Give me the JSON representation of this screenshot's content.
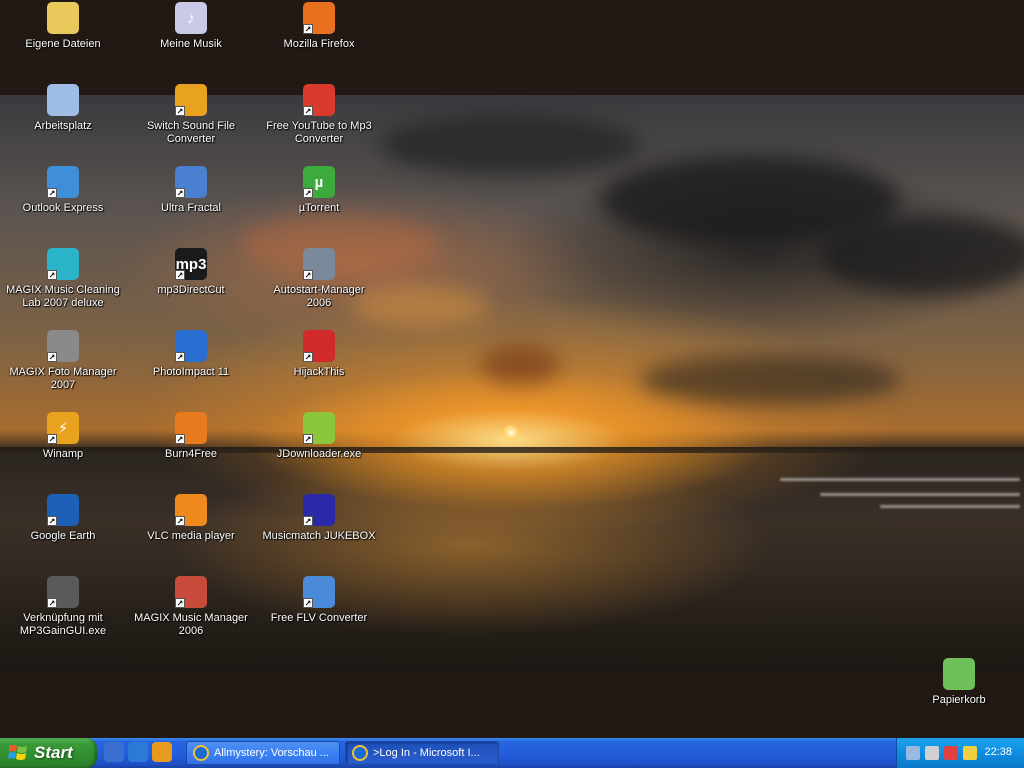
{
  "desktop": {
    "icons": [
      {
        "label": "Eigene Dateien",
        "icon": "folder-icon",
        "color": "#e9c95b",
        "glyph": "",
        "shortcut": false
      },
      {
        "label": "Meine Musik",
        "icon": "music-cd-icon",
        "color": "#c9c9e8",
        "glyph": "♪",
        "shortcut": false
      },
      {
        "label": "Mozilla Firefox",
        "icon": "firefox-icon",
        "color": "#e8701e",
        "glyph": "",
        "shortcut": true
      },
      {
        "label": "Arbeitsplatz",
        "icon": "computer-icon",
        "color": "#9fbde6",
        "glyph": "",
        "shortcut": false
      },
      {
        "label": "Switch Sound File Converter",
        "icon": "switch-converter-icon",
        "color": "#e8a21e",
        "glyph": "",
        "shortcut": true
      },
      {
        "label": "Free YouTube to Mp3 Converter",
        "icon": "youtube-mp3-icon",
        "color": "#d93a2b",
        "glyph": "",
        "shortcut": true
      },
      {
        "label": "Outlook Express",
        "icon": "outlook-express-icon",
        "color": "#3f8fd8",
        "glyph": "",
        "shortcut": true
      },
      {
        "label": "Ultra Fractal",
        "icon": "ultra-fractal-icon",
        "color": "#4b7fd0",
        "glyph": "",
        "shortcut": true
      },
      {
        "label": "µTorrent",
        "icon": "utorrent-icon",
        "color": "#3caa3c",
        "glyph": "µ",
        "shortcut": true
      },
      {
        "label": "MAGIX Music Cleaning Lab 2007 deluxe",
        "icon": "magix-cleaning-lab-icon",
        "color": "#2ab3c9",
        "glyph": "",
        "shortcut": true
      },
      {
        "label": "mp3DirectCut",
        "icon": "mp3directcut-icon",
        "color": "#1a1a1a",
        "glyph": "mp3",
        "shortcut": true
      },
      {
        "label": "Autostart-Manager 2006",
        "icon": "autostart-manager-icon",
        "color": "#7a8a9a",
        "glyph": "",
        "shortcut": true
      },
      {
        "label": "MAGIX Foto Manager 2007",
        "icon": "camera-icon",
        "color": "#8a8a8a",
        "glyph": "",
        "shortcut": true
      },
      {
        "label": "PhotoImpact 11",
        "icon": "photoimpact-icon",
        "color": "#2a6ed1",
        "glyph": "",
        "shortcut": true
      },
      {
        "label": "HijackThis",
        "icon": "hijackthis-icon",
        "color": "#d02a2a",
        "glyph": "",
        "shortcut": true
      },
      {
        "label": "Winamp",
        "icon": "winamp-icon",
        "color": "#e8a21e",
        "glyph": "⚡",
        "shortcut": true
      },
      {
        "label": "Burn4Free",
        "icon": "burn4free-icon",
        "color": "#e87a1e",
        "glyph": "",
        "shortcut": true
      },
      {
        "label": "JDownloader.exe",
        "icon": "jdownloader-icon",
        "color": "#8cc63a",
        "glyph": "",
        "shortcut": true
      },
      {
        "label": "Google Earth",
        "icon": "google-earth-icon",
        "color": "#1e5fb8",
        "glyph": "",
        "shortcut": true
      },
      {
        "label": "VLC media player",
        "icon": "vlc-cone-icon",
        "color": "#f08a1e",
        "glyph": "",
        "shortcut": true
      },
      {
        "label": "Musicmatch JUKEBOX",
        "icon": "musicmatch-icon",
        "color": "#2a2aa8",
        "glyph": "",
        "shortcut": true
      },
      {
        "label": "Verknüpfung mit MP3GainGUI.exe",
        "icon": "mp3gain-icon",
        "color": "#5a5a5a",
        "glyph": "",
        "shortcut": true
      },
      {
        "label": "MAGIX Music Manager 2006",
        "icon": "magix-music-manager-icon",
        "color": "#c84a3a",
        "glyph": "",
        "shortcut": true
      },
      {
        "label": "Free FLV Converter",
        "icon": "flv-converter-icon",
        "color": "#4a8ad8",
        "glyph": "",
        "shortcut": true
      },
      {
        "label": "Papierkorb",
        "icon": "recycle-bin-icon",
        "color": "#6fbf5a",
        "glyph": "",
        "shortcut": false
      }
    ]
  },
  "taskbar": {
    "start_label": "Start",
    "quick_launch": [
      {
        "icon": "show-desktop-icon",
        "color": "#3a6fd0"
      },
      {
        "icon": "internet-explorer-icon",
        "color": "#2a7ad8"
      },
      {
        "icon": "media-player-icon",
        "color": "#e89a1e"
      }
    ],
    "tasks": [
      {
        "label": "Allmystery: Vorschau ...",
        "icon": "internet-explorer-icon",
        "active": false
      },
      {
        "label": ">Log In - Microsoft I...",
        "icon": "internet-explorer-icon",
        "active": true
      }
    ],
    "tray_icons": [
      {
        "icon": "network-icon",
        "color": "#9bb8e0"
      },
      {
        "icon": "volume-icon",
        "color": "#d0d0d0"
      },
      {
        "icon": "monitor-icon",
        "color": "#e04040"
      },
      {
        "icon": "security-icon",
        "color": "#f0d040"
      }
    ],
    "clock": "22:38"
  }
}
